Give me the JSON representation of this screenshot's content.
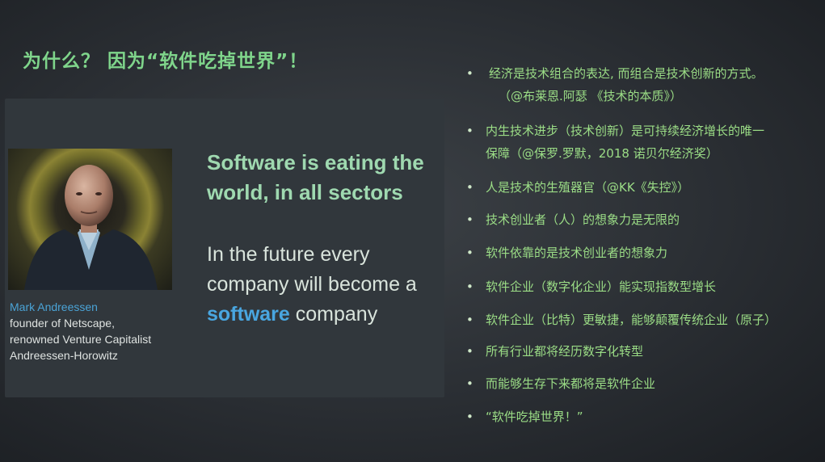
{
  "slide": {
    "title": "为什么？  因为“软件吃掉世界”！",
    "person": {
      "name": "Mark Andreessen",
      "line1": "founder of Netscape,",
      "line2": "renowned Venture Capitalist",
      "line3": "Andreessen-Horowitz"
    },
    "quote_line1": "Software is eating the",
    "quote_line2": "world, in all sectors",
    "future_line1": "In the future every",
    "future_line2": "company will become a",
    "future_highlight": "software",
    "future_tail": " company",
    "bullet_glyph": "•",
    "bullets": [
      {
        "l1": "经济是技术组合的表达, 而组合是技术创新的方式。",
        "l2": "（@布莱恩.阿瑟 《技术的本质》）"
      },
      {
        "l1": "内生技术进步（技术创新）是可持续经济增长的唯一",
        "l2": "保障（@保罗.罗默，2018 诺贝尔经济奖）"
      },
      {
        "l1": "人是技术的生殖器官（@KK《失控》）"
      },
      {
        "l1": "技术创业者（人）的想象力是无限的"
      },
      {
        "l1": "软件依靠的是技术创业者的想象力"
      },
      {
        "l1": "软件企业（数字化企业）能实现指数型增长"
      },
      {
        "l1": "软件企业（比特）更敏捷，能够颠覆传统企业（原子）"
      },
      {
        "l1": "所有行业都将经历数字化转型"
      },
      {
        "l1": "而能够生存下来都将是软件企业"
      },
      {
        "l1": "“软件吃掉世界！”"
      }
    ]
  }
}
